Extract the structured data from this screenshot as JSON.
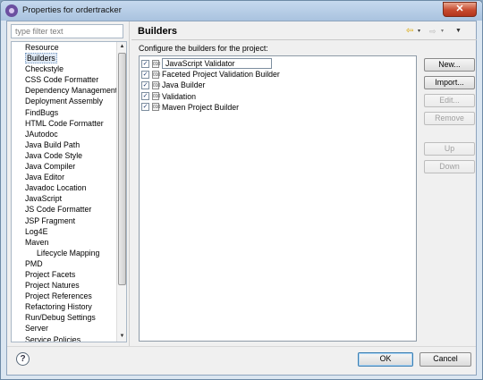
{
  "window": {
    "title": "Properties for ordertracker",
    "close_glyph": "✕"
  },
  "filter": {
    "placeholder": "type filter text"
  },
  "nav": {
    "items": [
      {
        "label": "Resource",
        "sub": false
      },
      {
        "label": "Builders",
        "sub": false,
        "selected": true
      },
      {
        "label": "Checkstyle",
        "sub": false
      },
      {
        "label": "CSS Code Formatter",
        "sub": false
      },
      {
        "label": "Dependency Management",
        "sub": false
      },
      {
        "label": "Deployment Assembly",
        "sub": false
      },
      {
        "label": "FindBugs",
        "sub": false
      },
      {
        "label": "HTML Code Formatter",
        "sub": false
      },
      {
        "label": "JAutodoc",
        "sub": false
      },
      {
        "label": "Java Build Path",
        "sub": false
      },
      {
        "label": "Java Code Style",
        "sub": false
      },
      {
        "label": "Java Compiler",
        "sub": false
      },
      {
        "label": "Java Editor",
        "sub": false
      },
      {
        "label": "Javadoc Location",
        "sub": false
      },
      {
        "label": "JavaScript",
        "sub": false
      },
      {
        "label": "JS Code Formatter",
        "sub": false
      },
      {
        "label": "JSP Fragment",
        "sub": false
      },
      {
        "label": "Log4E",
        "sub": false
      },
      {
        "label": "Maven",
        "sub": false
      },
      {
        "label": "Lifecycle Mapping",
        "sub": true
      },
      {
        "label": "PMD",
        "sub": false
      },
      {
        "label": "Project Facets",
        "sub": false
      },
      {
        "label": "Project Natures",
        "sub": false
      },
      {
        "label": "Project References",
        "sub": false
      },
      {
        "label": "Refactoring History",
        "sub": false
      },
      {
        "label": "Run/Debug Settings",
        "sub": false
      },
      {
        "label": "Server",
        "sub": false
      },
      {
        "label": "Service Policies",
        "sub": false
      }
    ]
  },
  "page": {
    "title": "Builders",
    "instruction": "Configure the builders for the project:",
    "builders": [
      {
        "label": "JavaScript Validator",
        "checked": true
      },
      {
        "label": "Faceted Project Validation Builder",
        "checked": true
      },
      {
        "label": "Java Builder",
        "checked": true
      },
      {
        "label": "Validation",
        "checked": true
      },
      {
        "label": "Maven Project Builder",
        "checked": true
      }
    ],
    "buttons": {
      "new": "New...",
      "import": "Import...",
      "edit": "Edit...",
      "remove": "Remove",
      "up": "Up",
      "down": "Down"
    }
  },
  "icons": {
    "back": "⇦",
    "forward": "⇨",
    "menu": "▼",
    "dropdown": "▾",
    "check": "✓",
    "help": "?"
  },
  "footer": {
    "ok": "OK",
    "cancel": "Cancel"
  }
}
